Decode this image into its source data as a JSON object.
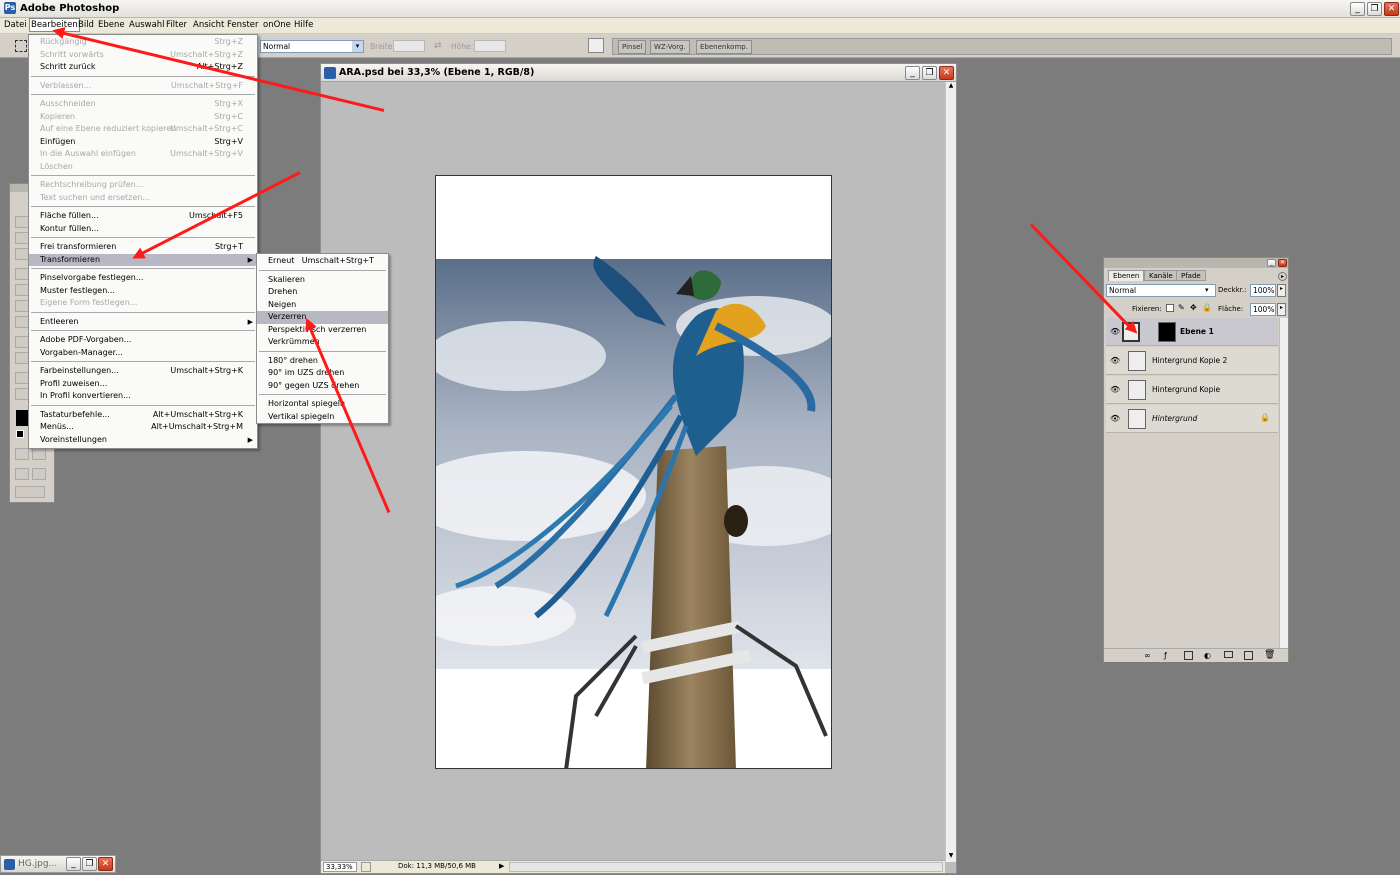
{
  "app": {
    "title": "Adobe Photoshop"
  },
  "menubar": {
    "items": [
      "Datei",
      "Bearbeiten",
      "Bild",
      "Ebene",
      "Auswahl",
      "Filter",
      "Ansicht",
      "Fenster",
      "onOne",
      "Hilfe"
    ]
  },
  "optbar": {
    "mode_value": "Normal",
    "width_label": "Breite:",
    "height_label": "Höhe:",
    "well_tabs": [
      "Pinsel",
      "WZ-Vorg.",
      "Ebenenkomp."
    ]
  },
  "edit_menu": {
    "items": [
      {
        "label": "Rückgängig",
        "shortcut": "Strg+Z",
        "disabled": true
      },
      {
        "label": "Schritt vorwärts",
        "shortcut": "Umschalt+Strg+Z",
        "disabled": true
      },
      {
        "label": "Schritt zurück",
        "shortcut": "Alt+Strg+Z",
        "disabled": false
      },
      {
        "sep": true
      },
      {
        "label": "Verblassen...",
        "shortcut": "Umschalt+Strg+F",
        "disabled": true
      },
      {
        "sep": true
      },
      {
        "label": "Ausschneiden",
        "shortcut": "Strg+X",
        "disabled": true
      },
      {
        "label": "Kopieren",
        "shortcut": "Strg+C",
        "disabled": true
      },
      {
        "label": "Auf eine Ebene reduziert kopieren",
        "shortcut": "Umschalt+Strg+C",
        "disabled": true
      },
      {
        "label": "Einfügen",
        "shortcut": "Strg+V",
        "disabled": false
      },
      {
        "label": "In die Auswahl einfügen",
        "shortcut": "Umschalt+Strg+V",
        "disabled": true
      },
      {
        "label": "Löschen",
        "shortcut": "",
        "disabled": true
      },
      {
        "sep": true
      },
      {
        "label": "Rechtschreibung prüfen...",
        "shortcut": "",
        "disabled": true
      },
      {
        "label": "Text suchen und ersetzen...",
        "shortcut": "",
        "disabled": true
      },
      {
        "sep": true
      },
      {
        "label": "Fläche füllen...",
        "shortcut": "Umschalt+F5",
        "disabled": false
      },
      {
        "label": "Kontur füllen...",
        "shortcut": "",
        "disabled": false
      },
      {
        "sep": true
      },
      {
        "label": "Frei transformieren",
        "shortcut": "Strg+T",
        "disabled": false
      },
      {
        "label": "Transformieren",
        "shortcut": "",
        "disabled": false,
        "submenu": true,
        "highlight": true
      },
      {
        "sep": true
      },
      {
        "label": "Pinselvorgabe festlegen...",
        "shortcut": "",
        "disabled": false
      },
      {
        "label": "Muster festlegen...",
        "shortcut": "",
        "disabled": false
      },
      {
        "label": "Eigene Form festlegen...",
        "shortcut": "",
        "disabled": true
      },
      {
        "sep": true
      },
      {
        "label": "Entleeren",
        "shortcut": "",
        "disabled": false,
        "submenu": true
      },
      {
        "sep": true
      },
      {
        "label": "Adobe PDF-Vorgaben...",
        "shortcut": "",
        "disabled": false
      },
      {
        "label": "Vorgaben-Manager...",
        "shortcut": "",
        "disabled": false
      },
      {
        "sep": true
      },
      {
        "label": "Farbeinstellungen...",
        "shortcut": "Umschalt+Strg+K",
        "disabled": false
      },
      {
        "label": "Profil zuweisen...",
        "shortcut": "",
        "disabled": false
      },
      {
        "label": "In Profil konvertieren...",
        "shortcut": "",
        "disabled": false
      },
      {
        "sep": true
      },
      {
        "label": "Tastaturbefehle...",
        "shortcut": "Alt+Umschalt+Strg+K",
        "disabled": false
      },
      {
        "label": "Menüs...",
        "shortcut": "Alt+Umschalt+Strg+M",
        "disabled": false
      },
      {
        "label": "Voreinstellungen",
        "shortcut": "",
        "disabled": false,
        "submenu": true
      }
    ]
  },
  "transform_menu": {
    "items": [
      {
        "label": "Erneut",
        "shortcut": "Umschalt+Strg+T"
      },
      {
        "sep": true
      },
      {
        "label": "Skalieren",
        "shortcut": ""
      },
      {
        "label": "Drehen",
        "shortcut": ""
      },
      {
        "label": "Neigen",
        "shortcut": ""
      },
      {
        "label": "Verzerren",
        "shortcut": "",
        "highlight": true
      },
      {
        "label": "Perspektivisch verzerren",
        "shortcut": ""
      },
      {
        "label": "Verkrümmen",
        "shortcut": ""
      },
      {
        "sep": true
      },
      {
        "label": "180° drehen",
        "shortcut": ""
      },
      {
        "label": "90° im UZS drehen",
        "shortcut": ""
      },
      {
        "label": "90° gegen UZS drehen",
        "shortcut": ""
      },
      {
        "sep": true
      },
      {
        "label": "Horizontal spiegeln",
        "shortcut": ""
      },
      {
        "label": "Vertikal spiegeln",
        "shortcut": ""
      }
    ]
  },
  "document": {
    "title": "ARA.psd bei 33,3% (Ebene 1, RGB/8)",
    "zoom": "33,33%",
    "doc_info": "Dok: 11,3 MB/50,6 MB"
  },
  "layers": {
    "tabs": [
      "Ebenen",
      "Kanäle",
      "Pfade"
    ],
    "mode": "Normal",
    "opacity_label": "Deckkr.:",
    "opacity": "100%",
    "lock_label": "Fixieren:",
    "fill_label": "Fläche:",
    "fill": "100%",
    "items": [
      {
        "name": "Ebene 1",
        "selected": true,
        "has_mask": true
      },
      {
        "name": "Hintergrund Kopie 2",
        "selected": false
      },
      {
        "name": "Hintergrund Kopie",
        "selected": false
      },
      {
        "name": "Hintergrund",
        "selected": false,
        "locked": true,
        "italic": true
      }
    ]
  },
  "minimized_doc": {
    "title": "HG.jpg..."
  },
  "colors": {
    "annotation_arrow": "#ff1a1a",
    "menu_highlight": "#b8b8c4"
  }
}
